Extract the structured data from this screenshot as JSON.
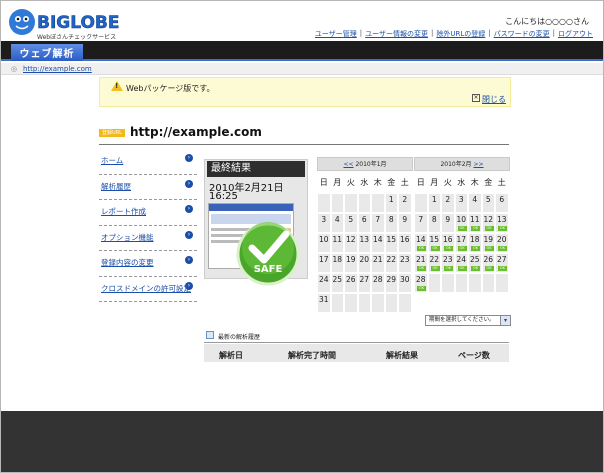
{
  "header": {
    "logo_text": "BIGLOBE",
    "logo_sub": "Webぼさんチェックサービス",
    "greeting": "こんにちは○○○○さん",
    "nav": [
      "ユーザー管理",
      "ユーザー情報の変更",
      "除外URLの登録",
      "パスワードの変更",
      "ログアウト"
    ],
    "tab_label": "ウェブ解析"
  },
  "breadcrumb": {
    "url": "http://example.com"
  },
  "notice": {
    "text": "Webパッケージ版です。",
    "close_label": "閉じる"
  },
  "site": {
    "tag": "登録URL",
    "url": "http://example.com"
  },
  "menu": [
    "ホーム",
    "解析履歴",
    "レポート作成",
    "オプション機能",
    "登録内容の変更",
    "クロスドメインの許可設定"
  ],
  "result": {
    "title": "最終結果",
    "date": "2010年2月21日",
    "time": "16:25",
    "badge": "SAFE"
  },
  "calendars": [
    {
      "prev": "<<",
      "month_label": "2010年1月",
      "next": "",
      "weekdays": [
        "日",
        "月",
        "火",
        "水",
        "木",
        "金",
        "土"
      ],
      "weeks": [
        [
          "",
          "",
          "",
          "",
          "",
          "1",
          "2"
        ],
        [
          "3",
          "4",
          "5",
          "6",
          "7",
          "8",
          "9"
        ],
        [
          "10",
          "11",
          "12",
          "13",
          "14",
          "15",
          "16"
        ],
        [
          "17",
          "18",
          "19",
          "20",
          "21",
          "22",
          "23"
        ],
        [
          "24",
          "25",
          "26",
          "27",
          "28",
          "29",
          "30"
        ],
        [
          "31",
          "",
          "",
          "",
          "",
          "",
          ""
        ]
      ],
      "ok_days": []
    },
    {
      "prev": "",
      "month_label": "2010年2月",
      "next": ">>",
      "weekdays": [
        "日",
        "月",
        "火",
        "水",
        "木",
        "金",
        "土"
      ],
      "weeks": [
        [
          "",
          "1",
          "2",
          "3",
          "4",
          "5",
          "6"
        ],
        [
          "7",
          "8",
          "9",
          "10",
          "11",
          "12",
          "13"
        ],
        [
          "14",
          "15",
          "16",
          "17",
          "18",
          "19",
          "20"
        ],
        [
          "21",
          "22",
          "23",
          "24",
          "25",
          "26",
          "27"
        ],
        [
          "28",
          "",
          "",
          "",
          "",
          "",
          ""
        ]
      ],
      "ok_days": [
        "10",
        "11",
        "12",
        "13",
        "14",
        "15",
        "16",
        "17",
        "18",
        "19",
        "20",
        "21",
        "22",
        "23",
        "24",
        "25",
        "26",
        "27",
        "28"
      ]
    }
  ],
  "ok_label": "OK",
  "period_select": {
    "value": "期間を選択してください。"
  },
  "history": {
    "title": "最新の解析履歴",
    "columns": [
      "解析日",
      "解析完了時間",
      "解析結果",
      "ページ数"
    ]
  },
  "colors": {
    "accent": "#3f6dcf",
    "ok": "#6bbe2c",
    "footer": "#333333"
  }
}
